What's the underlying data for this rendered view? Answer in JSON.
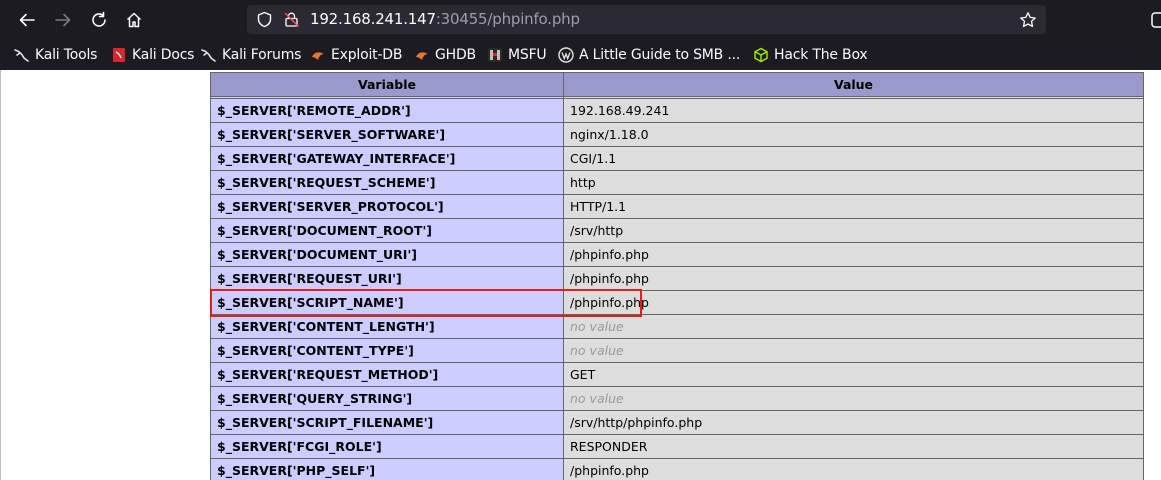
{
  "url": {
    "host": "192.168.241.147",
    "rest": ":30455/phpinfo.php"
  },
  "bookmarks": [
    {
      "label": "Kali Tools"
    },
    {
      "label": "Kali Docs"
    },
    {
      "label": "Kali Forums"
    },
    {
      "label": "Exploit-DB"
    },
    {
      "label": "GHDB"
    },
    {
      "label": "MSFU"
    },
    {
      "label": "A Little Guide to SMB ..."
    },
    {
      "label": "Hack The Box"
    }
  ],
  "table": {
    "headers": [
      "Variable",
      "Value"
    ],
    "rows": [
      {
        "variable": "$_SERVER['REMOTE_ADDR']",
        "value": "192.168.49.241"
      },
      {
        "variable": "$_SERVER['SERVER_SOFTWARE']",
        "value": "nginx/1.18.0"
      },
      {
        "variable": "$_SERVER['GATEWAY_INTERFACE']",
        "value": "CGI/1.1"
      },
      {
        "variable": "$_SERVER['REQUEST_SCHEME']",
        "value": "http"
      },
      {
        "variable": "$_SERVER['SERVER_PROTOCOL']",
        "value": "HTTP/1.1"
      },
      {
        "variable": "$_SERVER['DOCUMENT_ROOT']",
        "value": "/srv/http"
      },
      {
        "variable": "$_SERVER['DOCUMENT_URI']",
        "value": "/phpinfo.php"
      },
      {
        "variable": "$_SERVER['REQUEST_URI']",
        "value": "/phpinfo.php"
      },
      {
        "variable": "$_SERVER['SCRIPT_NAME']",
        "value": "/phpinfo.php"
      },
      {
        "variable": "$_SERVER['CONTENT_LENGTH']",
        "value": "no value"
      },
      {
        "variable": "$_SERVER['CONTENT_TYPE']",
        "value": "no value"
      },
      {
        "variable": "$_SERVER['REQUEST_METHOD']",
        "value": "GET"
      },
      {
        "variable": "$_SERVER['QUERY_STRING']",
        "value": "no value"
      },
      {
        "variable": "$_SERVER['SCRIPT_FILENAME']",
        "value": "/srv/http/phpinfo.php"
      },
      {
        "variable": "$_SERVER['FCGI_ROLE']",
        "value": "RESPONDER"
      },
      {
        "variable": "$_SERVER['PHP_SELF']",
        "value": "/phpinfo.php"
      }
    ]
  },
  "highlight_color": "#e02020"
}
